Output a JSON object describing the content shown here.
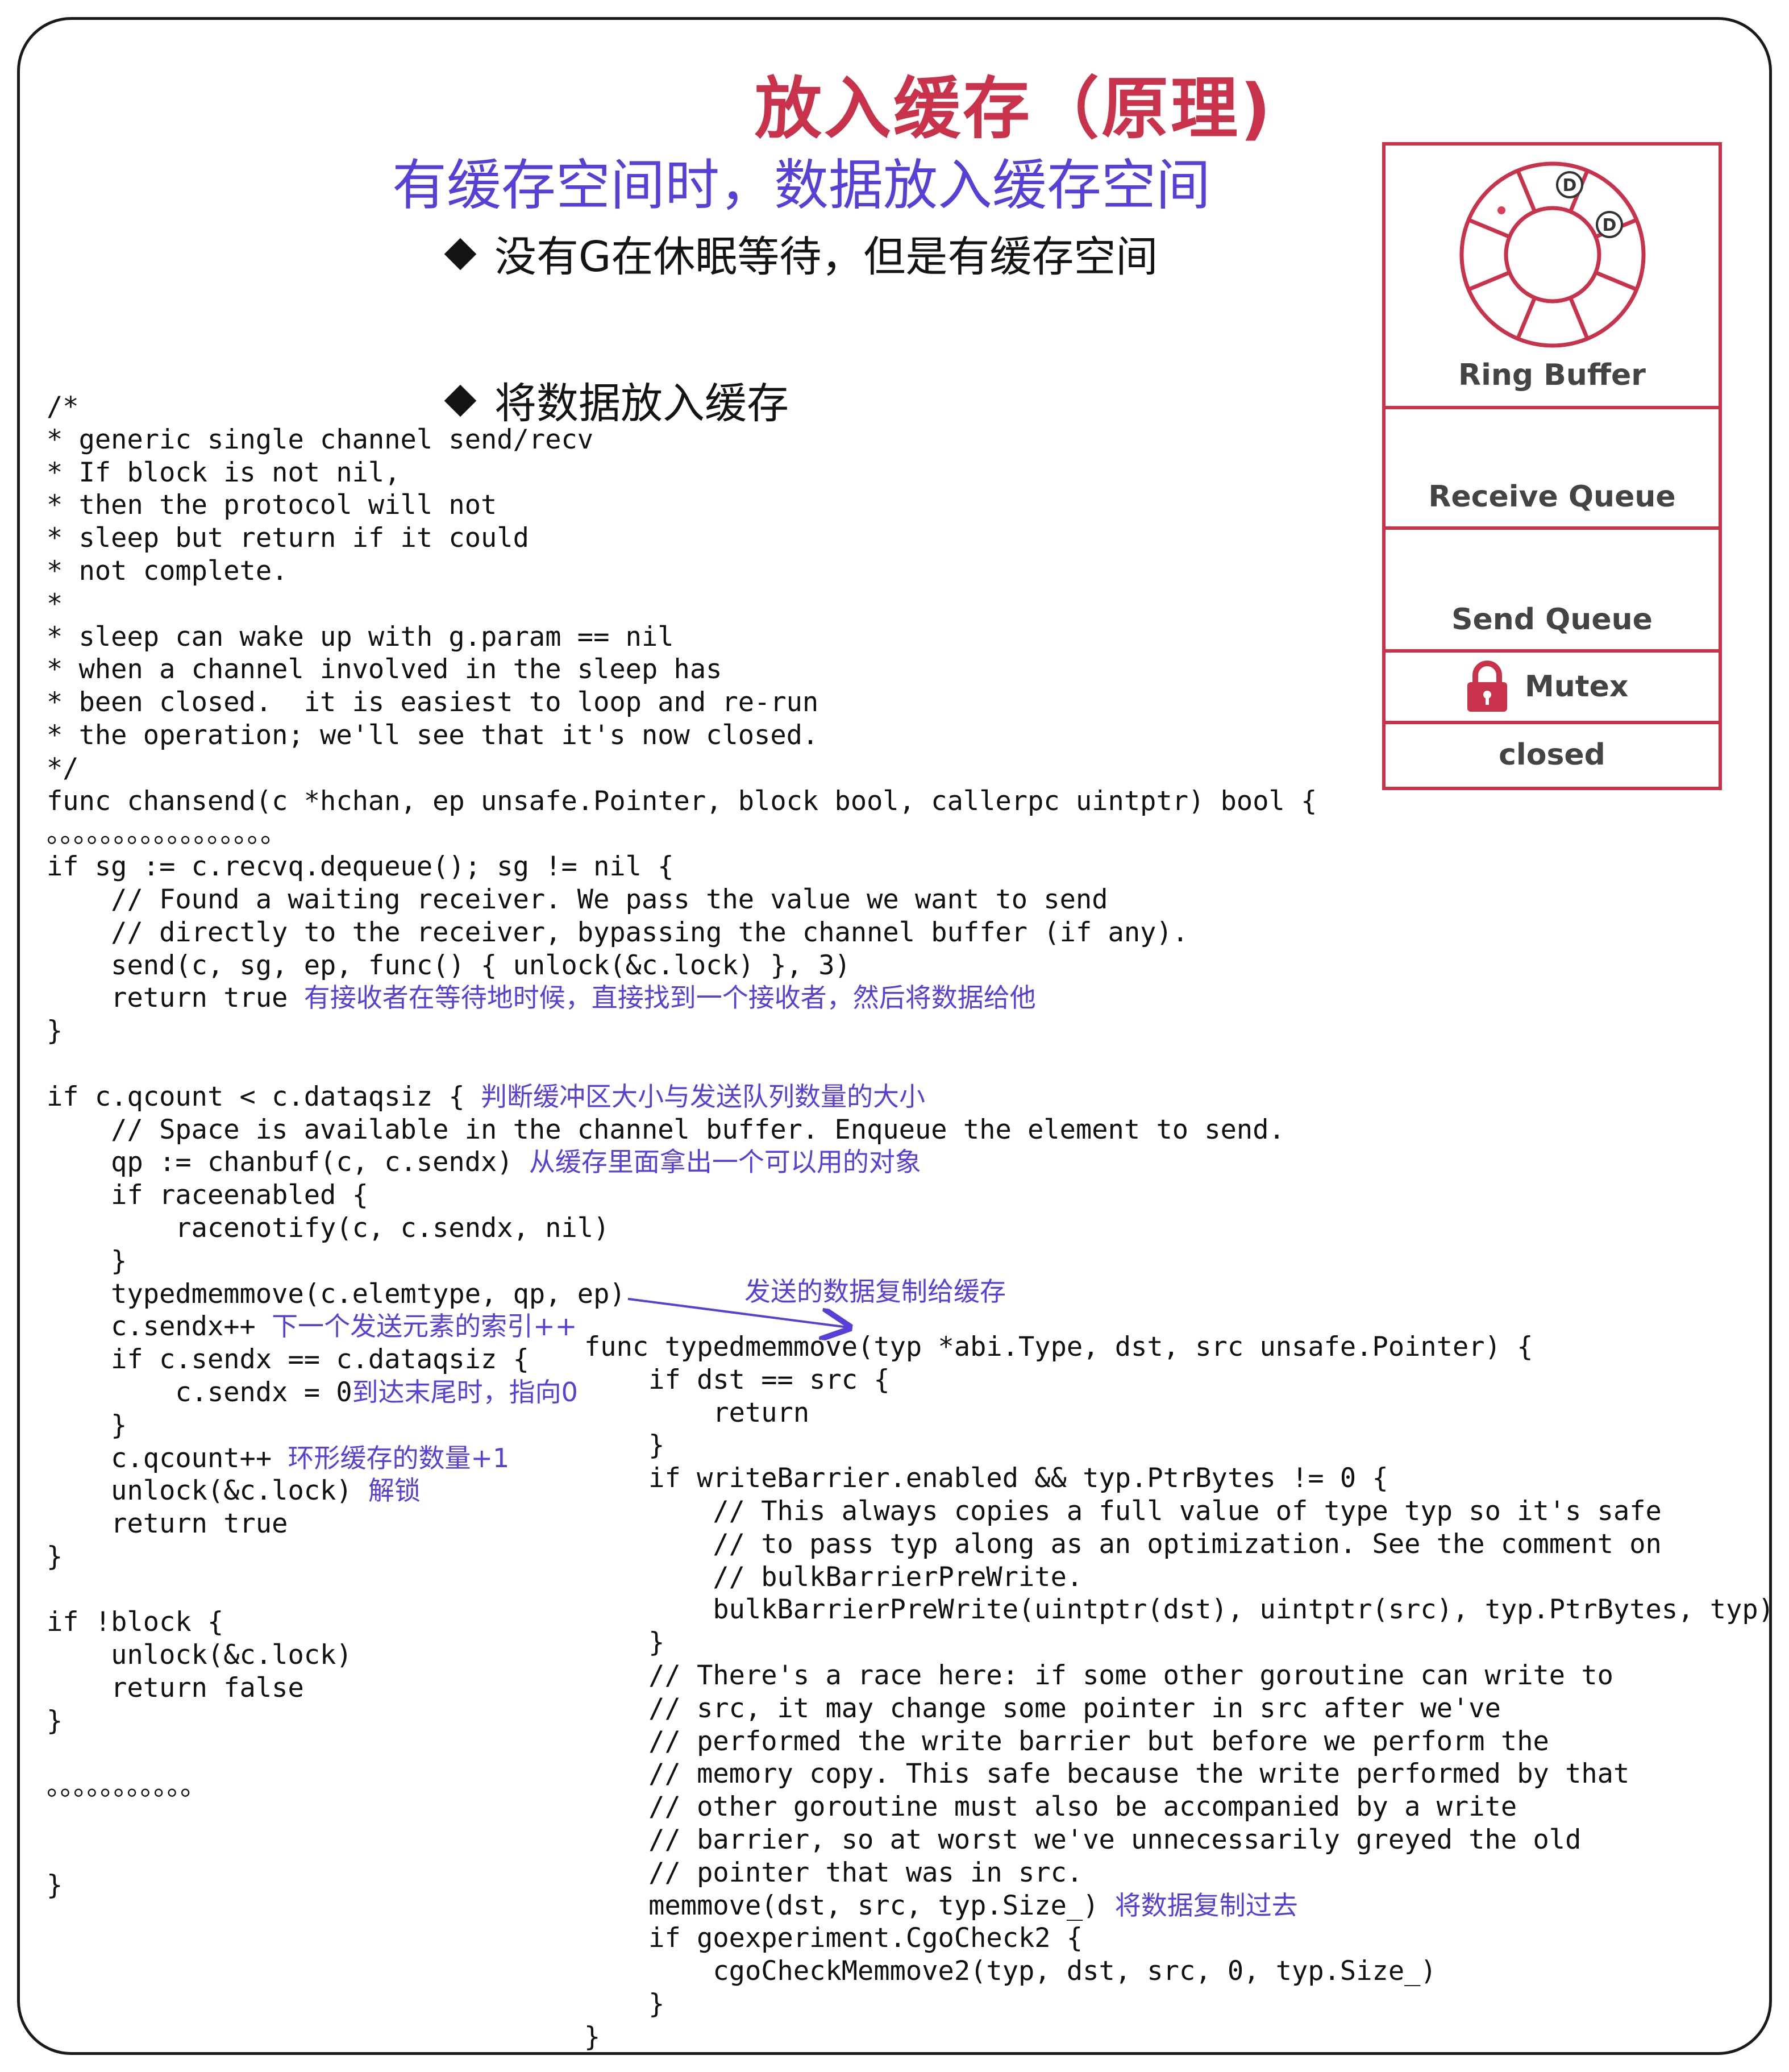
{
  "title": "放入缓存（原理)",
  "subtitle": "有缓存空间时，数据放入缓存空间",
  "bullets": [
    "没有G在休眠等待，但是有缓存空间",
    "将数据放入缓存"
  ],
  "panel": {
    "ring_label": "Ring Buffer",
    "receive_queue": "Receive Queue",
    "send_queue": "Send Queue",
    "mutex": "Mutex",
    "closed": "closed",
    "ring_markers": [
      "D",
      "D"
    ],
    "colors": {
      "border": "#c8324b",
      "lock": "#c8324b"
    },
    "icons": [
      "ring-buffer-icon",
      "lock-icon"
    ]
  },
  "left_code": [
    "/*",
    "* generic single channel send/recv",
    "* If block is not nil,",
    "* then the protocol will not",
    "* sleep but return if it could",
    "* not complete.",
    "*",
    "* sleep can wake up with g.param == nil",
    "* when a channel involved in the sleep has",
    "* been closed.  it is easiest to loop and re-run",
    "* the operation; we'll see that it's now closed.",
    "*/",
    "func chansend(c *hchan, ep unsafe.Pointer, block bool, callerpc uintptr) bool {",
    "。。。。。。。。。。。。。。。。。",
    "if sg := c.recvq.dequeue(); sg != nil {",
    "    // Found a waiting receiver. We pass the value we want to send",
    "    // directly to the receiver, bypassing the channel buffer (if any).",
    "    send(c, sg, ep, func() { unlock(&c.lock) }, 3)",
    "    return true ",
    "}",
    "",
    "if c.qcount < c.dataqsiz { ",
    "    // Space is available in the channel buffer. Enqueue the element to send.",
    "    qp := chanbuf(c, c.sendx) ",
    "    if raceenabled {",
    "        racenotify(c, c.sendx, nil)",
    "    }",
    "    typedmemmove(c.elemtype, qp, ep)",
    "    c.sendx++ ",
    "    if c.sendx == c.dataqsiz {",
    "        c.sendx = 0",
    "    }",
    "    c.qcount++ ",
    "    unlock(&c.lock) ",
    "    return true",
    "}",
    "",
    "if !block {",
    "    unlock(&c.lock)",
    "    return false",
    "}",
    "",
    "。。。。。。。。。。。",
    "",
    "",
    "}"
  ],
  "right_code": [
    "func typedmemmove(typ *abi.Type, dst, src unsafe.Pointer) {",
    "    if dst == src {",
    "        return",
    "    }",
    "    if writeBarrier.enabled && typ.PtrBytes != 0 {",
    "        // This always copies a full value of type typ so it's safe",
    "        // to pass typ along as an optimization. See the comment on",
    "        // bulkBarrierPreWrite.",
    "        bulkBarrierPreWrite(uintptr(dst), uintptr(src), typ.PtrBytes, typ)",
    "    }",
    "    // There's a race here: if some other goroutine can write to",
    "    // src, it may change some pointer in src after we've",
    "    // performed the write barrier but before we perform the",
    "    // memory copy. This safe because the write performed by that",
    "    // other goroutine must also be accompanied by a write",
    "    // barrier, so at worst we've unnecessarily greyed the old",
    "    // pointer that was in src.",
    "    memmove(dst, src, typ.Size_) ",
    "    if goexperiment.CgoCheck2 {",
    "        cgoCheckMemmove2(typ, dst, src, 0, typ.Size_)",
    "    }",
    "}"
  ],
  "annotations": {
    "return_true": "有接收者在等待地时候，直接找到一个接收者，然后将数据给他",
    "qcount_check": "判断缓冲区大小与发送队列数量的大小",
    "chanbuf": "从缓存里面拿出一个可以用的对象",
    "copy_to_buffer": "发送的数据复制给缓存",
    "sendx_inc": "下一个发送元素的索引++",
    "sendx_reset": "到达末尾时，指向0",
    "qcount_inc": "环形缓存的数量+1",
    "unlock": "解锁",
    "memmove": "将数据复制过去"
  },
  "annotation_color": "#5a3fd6"
}
